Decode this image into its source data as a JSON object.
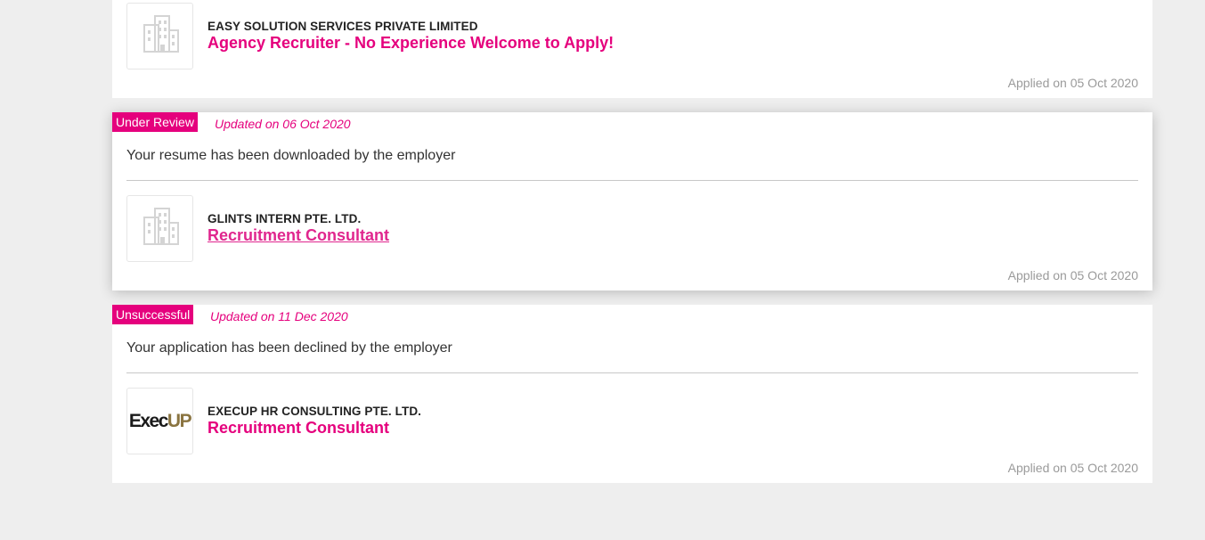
{
  "applications": [
    {
      "company": "EASY SOLUTION SERVICES PRIVATE LIMITED",
      "job_title": "Agency Recruiter - No Experience Welcome to Apply!",
      "applied": "Applied on 05 Oct 2020",
      "logo_icon": "building-icon"
    },
    {
      "status": "Under Review",
      "updated": "Updated on 06 Oct 2020",
      "message": "Your resume has been downloaded by the employer",
      "company": "GLINTS INTERN PTE. LTD.",
      "job_title": "Recruitment Consultant",
      "applied": "Applied on 05 Oct 2020",
      "logo_icon": "building-icon"
    },
    {
      "status": "Unsuccessful",
      "updated": "Updated on 11 Dec 2020",
      "message": "Your application has been declined by the employer",
      "company": "EXECUP HR CONSULTING PTE. LTD.",
      "job_title": "Recruitment Consultant",
      "applied": "Applied on 05 Oct 2020",
      "logo": {
        "text_main": "Exec",
        "text_accent": "UP"
      }
    }
  ],
  "colors": {
    "accent": "#e5007d",
    "background": "#eeeeee",
    "card": "#ffffff",
    "muted_text": "#9a9a9a",
    "logo_accent": "#8a7440"
  }
}
